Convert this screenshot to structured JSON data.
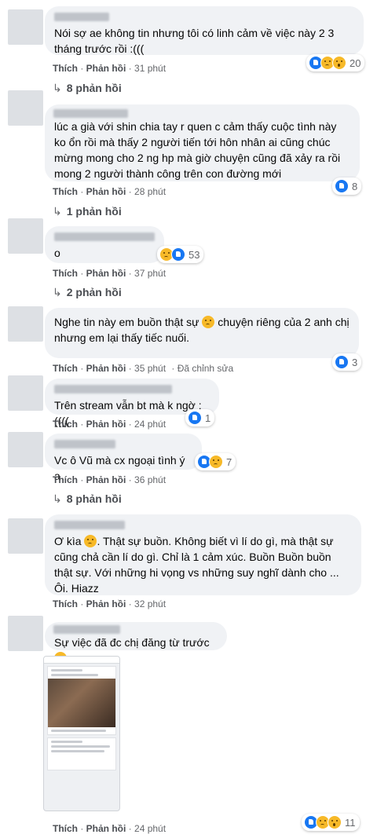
{
  "comments": [
    {
      "id": 1,
      "text": "Nói sợ ae không tin nhưng tôi có linh cảm về việc này 2 3 tháng trước rồi :(((",
      "like": "Thích",
      "reply": "Phản hồi",
      "time": "31 phút",
      "reaction_count": "20",
      "replies": "8 phản hồi"
    },
    {
      "id": 2,
      "text": "lúc a già với shin chia tay r quen c cảm thấy cuộc tình này ko ổn rồi mà thấy 2 người tiến tới hôn nhân ai cũng chúc mừng mong cho 2 ng hp mà giờ chuyện cũng đã xảy ra rồi mong 2 người thành công trên con đường mới",
      "like": "Thích",
      "reply": "Phản hồi",
      "time": "28 phút",
      "reaction_count": "8",
      "replies": "1 phản hồi"
    },
    {
      "id": 3,
      "text": "o",
      "like": "Thích",
      "reply": "Phản hồi",
      "time": "37 phút",
      "reaction_count": "53",
      "replies": "2 phản hồi"
    },
    {
      "id": 4,
      "text_before": "Nghe tin này em buồn thật sự",
      "text_after": "chuyện riêng của 2 anh chị nhưng em lại thấy tiếc nuối.",
      "like": "Thích",
      "reply": "Phản hồi",
      "time": "35 phút",
      "edited": "Đã chỉnh sửa",
      "reaction_count": "3"
    },
    {
      "id": 5,
      "text": "Trên stream vẫn bt mà k ngờ :((((",
      "like": "Thích",
      "reply": "Phản hồi",
      "time": "24 phút",
      "reaction_count": "1"
    },
    {
      "id": 6,
      "text": "Vc ô Vũ mà cx ngoại tình ý a",
      "like": "Thích",
      "reply": "Phản hồi",
      "time": "36 phút",
      "reaction_count": "7",
      "replies": "8 phản hồi"
    },
    {
      "id": 7,
      "text_before": "Ơ kìa",
      "text_after": ". Thật sự buồn. Không biết vì lí do gì, mà thật sự cũng chả cần lí do gì. Chỉ là 1 cảm xúc. Buồn Buồn buồn thật sự. Với những hi vọng vs những suy nghĩ dành cho ... Ôi. Hiazz",
      "like": "Thích",
      "reply": "Phản hồi",
      "time": "32 phút"
    },
    {
      "id": 8,
      "text": "Sự việc đã đc chị đăng từ trước",
      "like": "Thích",
      "reply": "Phản hồi",
      "time": "24 phút",
      "reaction_count": "11"
    }
  ],
  "icons": {
    "like": "like-reaction-icon",
    "sad": "sad-reaction-icon",
    "wow": "wow-reaction-icon",
    "reply_arrow": "reply-arrow-icon"
  },
  "colors": {
    "bubble": "#f0f2f5",
    "meta": "#65676b",
    "like_blue": "#1877f2",
    "emoji_yellow": "#f7b928"
  }
}
